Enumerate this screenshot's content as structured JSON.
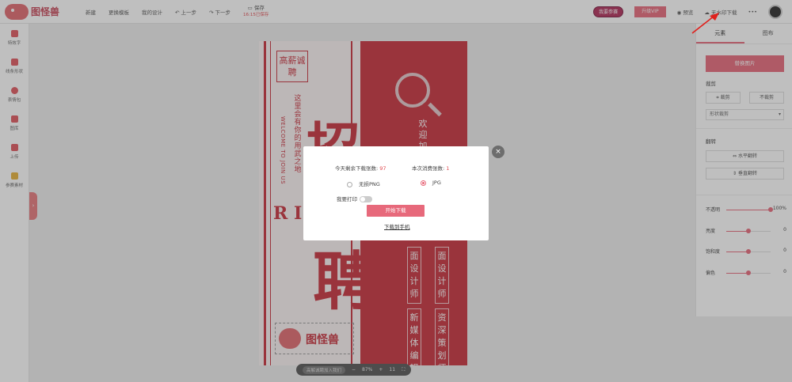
{
  "app": {
    "brand": "图怪兽"
  },
  "toolbar": {
    "new": "新建",
    "template": "更换模板",
    "my_design": "我的设计",
    "undo": "上一步",
    "redo": "下一步",
    "save": "保存",
    "save_time": "16:15已保存",
    "poster_btn": "我要参赛",
    "vip_btn": "升级VIP",
    "preview": "预览",
    "download": "无水印下载",
    "more": "•••"
  },
  "sidebar": {
    "items": [
      {
        "label": "特效字",
        "icon": "text-effect-icon"
      },
      {
        "label": "线条形状",
        "icon": "shape-icon"
      },
      {
        "label": "表情包",
        "icon": "emoji-icon"
      },
      {
        "label": "图库",
        "icon": "gallery-icon"
      },
      {
        "label": "上传",
        "icon": "upload-icon"
      },
      {
        "label": "参赛素材",
        "icon": "trophy-icon"
      }
    ]
  },
  "poster": {
    "box_text": "高薪诚聘",
    "vertical_text": "这里会有你的用武之地",
    "welcome": "WELCOME TO JOIN US",
    "big_char_1": "招",
    "big_char_2": "聘",
    "side_letters": "R I",
    "join": "欢迎加入",
    "tag_1": "面设计师",
    "tag_2": "面设计师",
    "tag_3": "新媒体编辑",
    "tag_4": "资深策划师",
    "logo_text": "图怪兽"
  },
  "zoom": {
    "hint": "高解诚聘加入我们",
    "minus": "−",
    "level": "87%",
    "plus": "+",
    "page": "11"
  },
  "modal": {
    "remaining_label": "今天剩余下载张数:",
    "remaining_value": "97",
    "consume_label": "本次消费张数:",
    "consume_value": "1",
    "option_png": "无损PNG",
    "option_jpg": "JPG",
    "selected_format": "JPG",
    "print_label": "我要打印",
    "start_btn": "开始下载",
    "phone_link": "下载到手机",
    "close": "×"
  },
  "rpanel": {
    "tab_element": "元素",
    "tab_layout": "图布",
    "replace_btn": "替换图片",
    "crop_label": "裁剪",
    "crop_btn": "裁剪",
    "no_crop_btn": "不裁剪",
    "shape_crop": "形状裁剪",
    "flip_label": "翻转",
    "flip_h": "水平翻转",
    "flip_v": "垂直翻转",
    "sliders": [
      {
        "label": "不透明",
        "value": "100%",
        "level": 1.0
      },
      {
        "label": "亮度",
        "value": "0",
        "level": 0.5
      },
      {
        "label": "饱和度",
        "value": "0",
        "level": 0.5
      },
      {
        "label": "偏色",
        "value": "0",
        "level": 0.5
      }
    ]
  },
  "colors": {
    "accent": "#e7697b",
    "poster_red": "#c8303c"
  }
}
